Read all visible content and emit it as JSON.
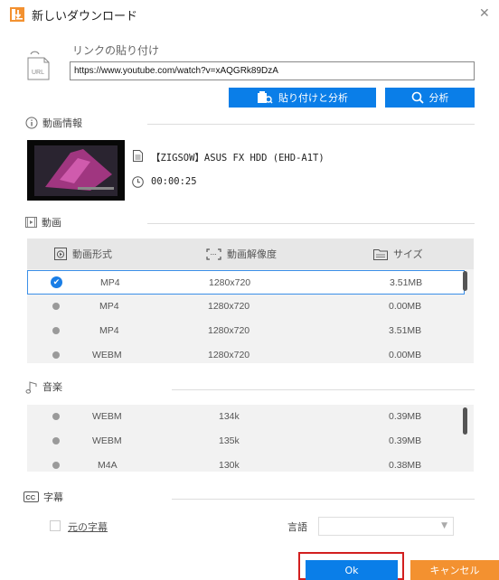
{
  "window": {
    "title": "新しいダウンロード",
    "close_icon": "close-icon"
  },
  "url_section": {
    "heading": "リンクの貼り付け",
    "url_value": "https://www.youtube.com/watch?v=xAQGRk89DzA",
    "paste_analyze_label": "貼り付けと分析",
    "analyze_label": "分析"
  },
  "video_info": {
    "heading": "動画情報",
    "title": "【ZIGSOW】ASUS FX HDD (EHD-A1T)",
    "duration": "00:00:25"
  },
  "video_section": {
    "heading": "動画",
    "columns": {
      "format": "動画形式",
      "resolution": "動画解像度",
      "size": "サイズ"
    },
    "rows": [
      {
        "format": "MP4",
        "resolution": "1280x720",
        "size": "3.51MB",
        "selected": true
      },
      {
        "format": "MP4",
        "resolution": "1280x720",
        "size": "0.00MB",
        "selected": false
      },
      {
        "format": "MP4",
        "resolution": "1280x720",
        "size": "3.51MB",
        "selected": false
      },
      {
        "format": "WEBM",
        "resolution": "1280x720",
        "size": "0.00MB",
        "selected": false
      }
    ]
  },
  "music_section": {
    "heading": "音楽",
    "rows": [
      {
        "format": "WEBM",
        "bitrate": "134k",
        "size": "0.39MB"
      },
      {
        "format": "WEBM",
        "bitrate": "135k",
        "size": "0.39MB"
      },
      {
        "format": "M4A",
        "bitrate": "130k",
        "size": "0.38MB"
      }
    ]
  },
  "subtitle_section": {
    "heading": "字幕",
    "original_subtitle_label": "元の字幕",
    "language_label": "言語",
    "language_value": ""
  },
  "footer": {
    "ok_label": "Ok",
    "cancel_label": "キャンセル"
  },
  "colors": {
    "accent": "#0a7ee8",
    "cancel": "#f39130",
    "highlight": "#d21f1f"
  }
}
